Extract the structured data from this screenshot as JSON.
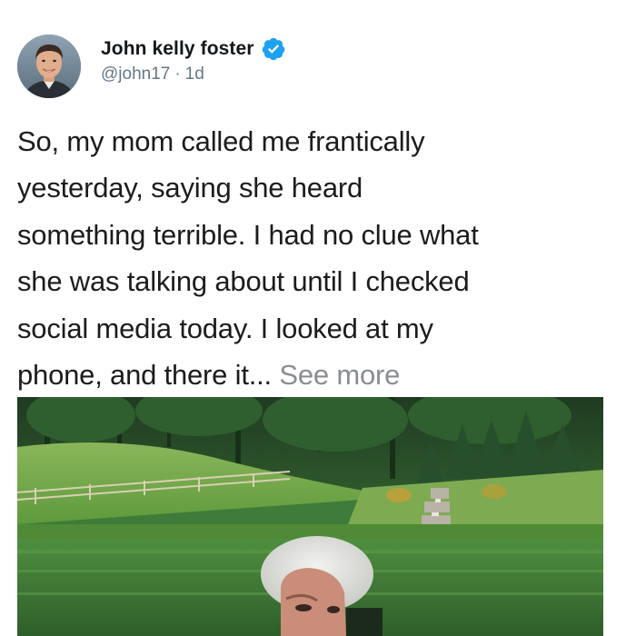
{
  "author": {
    "display_name": "John kelly foster",
    "handle": "@john17",
    "separator": "·",
    "time_ago": "1d",
    "verified": true,
    "verified_icon": "verified-badge-icon"
  },
  "post": {
    "lines": [
      "So, my mom called me frantically",
      "yesterday, saying she heard",
      "something terrible. I had no clue what",
      "she was talking about until I checked",
      "social media today. I looked at my"
    ],
    "last_line": "phone, and there it...",
    "see_more_label": "See more"
  },
  "colors": {
    "verified_blue": "#1da1f2",
    "text": "#1c1c1c",
    "muted": "#657786",
    "see_more": "#8a8d91"
  }
}
